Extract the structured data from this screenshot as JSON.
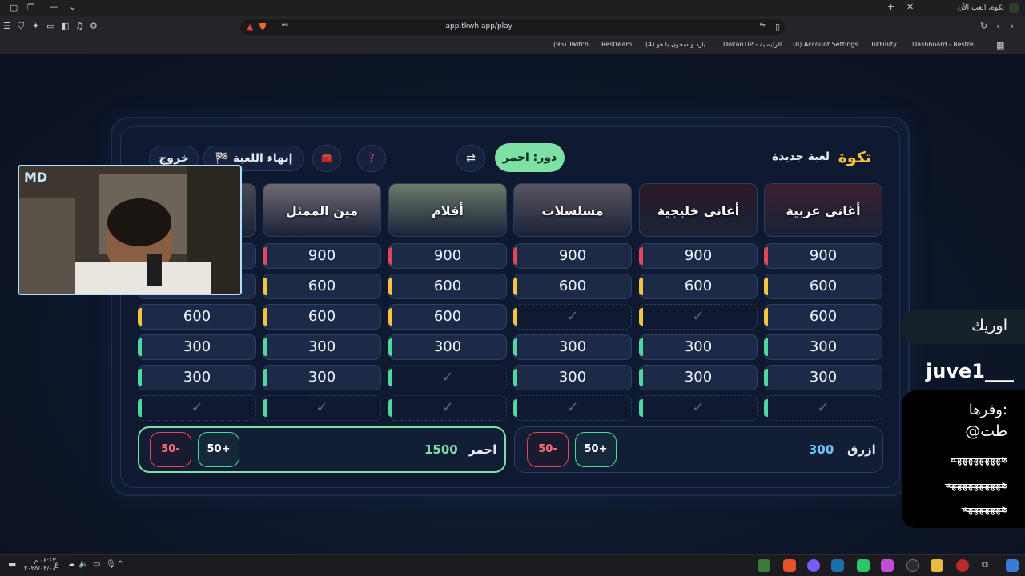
{
  "browser": {
    "tab_title": "تكوة، العب الآن",
    "url": "app.tkwh.app/play",
    "bookmarks": [
      "(95) Twitch",
      "Restream",
      "(4) بارد و سخون یا هو...",
      "DokanTIP - الرئيسية",
      "(8) Account Settings...",
      "TikFinity",
      "Dashboard - Restre..."
    ]
  },
  "game": {
    "brand": "تكوة",
    "new_game": "لعبة جديدة",
    "turn_label": "دور: احمر",
    "swap_icon": "⇄",
    "help_icon": "?",
    "lifeline_icon": "🧰",
    "end_game": "🏁 إنهاء اللعبة",
    "exit": "خروج"
  },
  "categories": [
    {
      "name": "أغاني عربية",
      "color": "#3a2030"
    },
    {
      "name": "أغاني خليجية",
      "color": "#2b1a28"
    },
    {
      "name": "مسلسلات",
      "color": "#5a5560"
    },
    {
      "name": "أفلام",
      "color": "#6c7a6a"
    },
    {
      "name": "مين الممثل",
      "color": "#6e6a72"
    },
    {
      "name": "",
      "color": "#4a4a50"
    }
  ],
  "tiles": [
    [
      "900",
      "600",
      "600",
      "300",
      "300",
      "✓"
    ],
    [
      "900",
      "600",
      "✓",
      "300",
      "300",
      "✓"
    ],
    [
      "900",
      "600",
      "✓",
      "300",
      "300",
      "✓"
    ],
    [
      "900",
      "600",
      "600",
      "300",
      "✓",
      "✓"
    ],
    [
      "900",
      "600",
      "600",
      "300",
      "300",
      "✓"
    ],
    [
      "",
      "",
      "600",
      "300",
      "300",
      "✓"
    ]
  ],
  "teams": {
    "blue": {
      "name": "ازرق",
      "score": "300",
      "plus": "50+",
      "minus": "50-"
    },
    "red": {
      "name": "احمر",
      "score": "1500",
      "plus": "50+",
      "minus": "50-"
    }
  },
  "chat": {
    "msg1": "اوريك",
    "username": "juve1___",
    "msg2_l1": "وفرها:",
    "msg2_l2": "@طت",
    "msg2_l3": "هههههههههه",
    "msg2_l4": "ههههههههههه",
    "msg2_l5": "هههههههه"
  },
  "taskbar": {
    "time": "٠٤:٤٣ م",
    "date": "٢٠٢٥/٠٣/٠٨",
    "lang": "ع"
  }
}
